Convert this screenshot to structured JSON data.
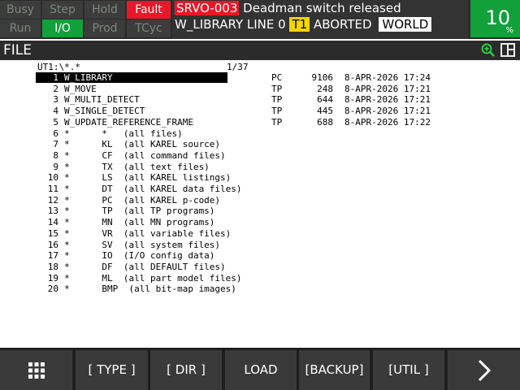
{
  "status": {
    "row1": [
      "Busy",
      "Step",
      "Hold",
      "Fault"
    ],
    "row2": [
      "Run",
      "I/O",
      "Prod",
      "TCyc"
    ]
  },
  "alarm": {
    "code": "SRVO-003",
    "message": "Deadman switch released",
    "program": "W_LIBRARY LINE 0",
    "mode": "T1",
    "state": "ABORTED",
    "frame": "WORLD"
  },
  "override": {
    "value": "10",
    "unit": "%"
  },
  "screen": {
    "title": "FILE"
  },
  "listing": {
    "path": "UT1:\\*.*",
    "page": "1/37",
    "rows": [
      {
        "num": "1",
        "name": "W_LIBRARY",
        "type": "PC",
        "size": "9106",
        "date": "8-APR-2026 17:24"
      },
      {
        "num": "2",
        "name": "W_MOVE",
        "type": "TP",
        "size": "248",
        "date": "8-APR-2026 17:21"
      },
      {
        "num": "3",
        "name": "W_MULTI_DETECT",
        "type": "TP",
        "size": "644",
        "date": "8-APR-2026 17:21"
      },
      {
        "num": "4",
        "name": "W_SINGLE_DETECT",
        "type": "TP",
        "size": "445",
        "date": "8-APR-2026 17:21"
      },
      {
        "num": "5",
        "name": "W_UPDATE_REFERENCE_FRAME",
        "type": "TP",
        "size": "688",
        "date": "8-APR-2026 17:22"
      },
      {
        "num": "6",
        "name": "*      *   (all files)"
      },
      {
        "num": "7",
        "name": "*      KL  (all KAREL source)"
      },
      {
        "num": "8",
        "name": "*      CF  (all command files)"
      },
      {
        "num": "9",
        "name": "*      TX  (all text files)"
      },
      {
        "num": "10",
        "name": "*      LS  (all KAREL listings)"
      },
      {
        "num": "11",
        "name": "*      DT  (all KAREL data files)"
      },
      {
        "num": "12",
        "name": "*      PC  (all KAREL p-code)"
      },
      {
        "num": "13",
        "name": "*      TP  (all TP programs)"
      },
      {
        "num": "14",
        "name": "*      MN  (all MN programs)"
      },
      {
        "num": "15",
        "name": "*      VR  (all variable files)"
      },
      {
        "num": "16",
        "name": "*      SV  (all system files)"
      },
      {
        "num": "17",
        "name": "*      IO  (I/O config data)"
      },
      {
        "num": "18",
        "name": "*      DF  (all DEFAULT files)"
      },
      {
        "num": "19",
        "name": "*      ML  (all part model files)"
      },
      {
        "num": "20",
        "name": "*      BMP  (all bit-map images)"
      }
    ]
  },
  "fkeys": [
    "[ TYPE ]",
    "[ DIR ]",
    "LOAD",
    "[BACKUP]",
    "[UTIL ]"
  ],
  "icons": {
    "menu": "grid-icon",
    "next": "chevron-right-icon",
    "zoom": "zoom-in-icon",
    "split": "split-window-icon"
  }
}
